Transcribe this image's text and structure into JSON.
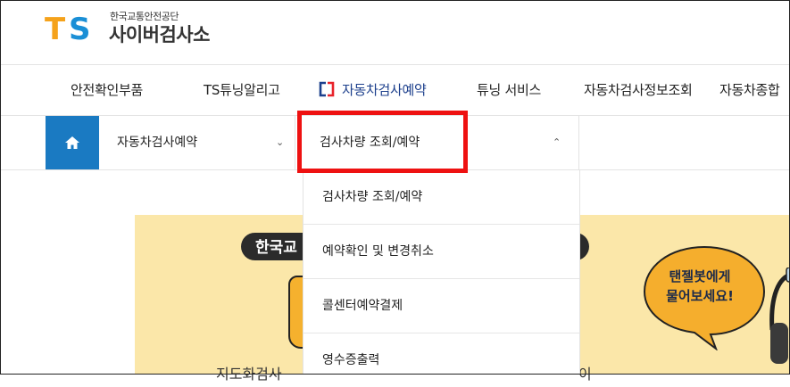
{
  "brand": {
    "mark": "TS",
    "org_name": "한국교통안전공단",
    "site_name": "사이버검사소",
    "colors": {
      "orange": "#f5a21b",
      "blue": "#1a8fd6"
    }
  },
  "gnb": {
    "items": [
      {
        "label": "안전확인부품"
      },
      {
        "label": "TS튜닝알리고"
      },
      {
        "label": "자동차검사예약",
        "active": true,
        "icon": "bracket-logo-icon"
      },
      {
        "label": "튜닝 서비스"
      },
      {
        "label": "자동차검사정보조회"
      },
      {
        "label": "자동차종합"
      }
    ]
  },
  "breadcrumb": {
    "home_icon": "home-icon",
    "level1": {
      "label": "자동차검사예약",
      "chevron": "chevron-down-icon"
    },
    "level2": {
      "label": "검사차량 조회/예약",
      "chevron": "chevron-up-icon",
      "highlight_color": "#ee1111"
    }
  },
  "dropdown": {
    "items": [
      {
        "label": "검사차량 조회/예약"
      },
      {
        "label": "예약확인 및 변경취소"
      },
      {
        "label": "콜센터예약결제"
      },
      {
        "label": "영수증출력"
      }
    ]
  },
  "banner": {
    "title_partial": "한국교",
    "bubble_line1": "탠젤봇에게",
    "bubble_line2": "물어보세요!",
    "bottom_text_left": "지도화검사",
    "bottom_text_right": "이"
  },
  "accent_colors": {
    "home_bg": "#1a7ac2",
    "active_text": "#1c3f8c",
    "banner_bg": "#fbe7a9",
    "red_box": "#ee1111"
  }
}
